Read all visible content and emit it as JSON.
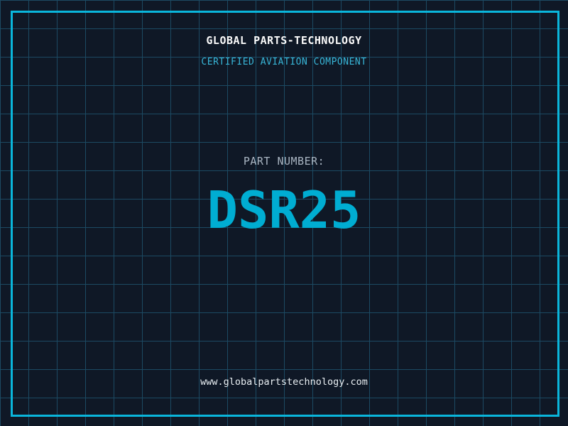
{
  "colors": {
    "background": "#0f1826",
    "grid_line": "#1c4a63",
    "frame_accent": "#0ab6dc",
    "title_text": "#fafafa",
    "subtitle_text": "#38b6d8",
    "part_label_text": "#a9b5c2",
    "part_number_text": "#00add2",
    "footer_text": "#e8eef2"
  },
  "header": {
    "title": "GLOBAL PARTS-TECHNOLOGY",
    "subtitle": "CERTIFIED AVIATION COMPONENT"
  },
  "part": {
    "label": "PART NUMBER:",
    "number": "DSR25"
  },
  "footer": {
    "url": "www.globalpartstechnology.com"
  }
}
